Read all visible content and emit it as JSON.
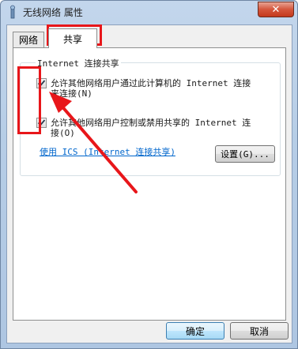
{
  "window": {
    "title": "无线网络 属性",
    "close_symbol": "✕"
  },
  "tabs": [
    {
      "label": "网络"
    },
    {
      "label": "共享"
    }
  ],
  "sharing": {
    "group_title": "Internet 连接共享",
    "allow_sharing": {
      "checked": true,
      "label": "允许其他网络用户通过此计算机的 Internet 连接\n来连接(N)"
    },
    "allow_control": {
      "checked": true,
      "label": "允许其他网络用户控制或禁用共享的 Internet 连\n接(O)"
    },
    "ics_link": "使用 ICS (Internet 连接共享)",
    "settings_button": "设置(G)..."
  },
  "footer": {
    "ok_button": "确定",
    "cancel_button": "取消"
  },
  "colors": {
    "annotation_red": "#e8161a",
    "link_blue": "#0066cc"
  }
}
